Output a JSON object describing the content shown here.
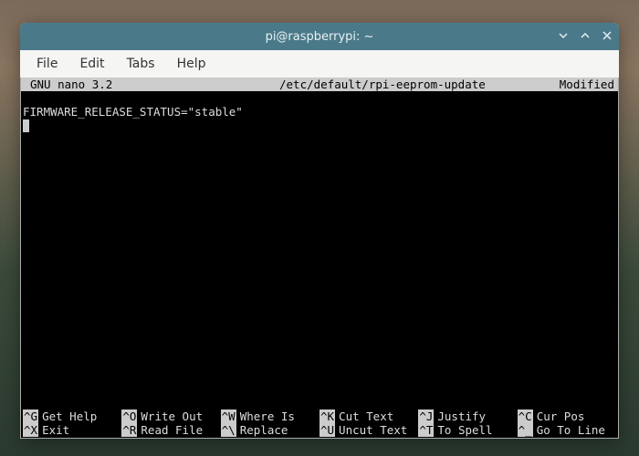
{
  "window": {
    "title": "pi@raspberrypi: ~"
  },
  "menu": {
    "file": "File",
    "edit": "Edit",
    "tabs": "Tabs",
    "help": "Help"
  },
  "nano": {
    "version": "GNU nano 3.2",
    "filepath": "/etc/default/rpi-eeprom-update",
    "status": "Modified",
    "content_line1": "FIRMWARE_RELEASE_STATUS=\"stable\"",
    "shortcuts_row1": [
      {
        "key": "^G",
        "label": "Get Help"
      },
      {
        "key": "^O",
        "label": "Write Out"
      },
      {
        "key": "^W",
        "label": "Where Is"
      },
      {
        "key": "^K",
        "label": "Cut Text"
      },
      {
        "key": "^J",
        "label": "Justify"
      },
      {
        "key": "^C",
        "label": "Cur Pos"
      }
    ],
    "shortcuts_row2": [
      {
        "key": "^X",
        "label": "Exit"
      },
      {
        "key": "^R",
        "label": "Read File"
      },
      {
        "key": "^\\",
        "label": "Replace"
      },
      {
        "key": "^U",
        "label": "Uncut Text"
      },
      {
        "key": "^T",
        "label": "To Spell"
      },
      {
        "key": "^_",
        "label": "Go To Line"
      }
    ]
  }
}
